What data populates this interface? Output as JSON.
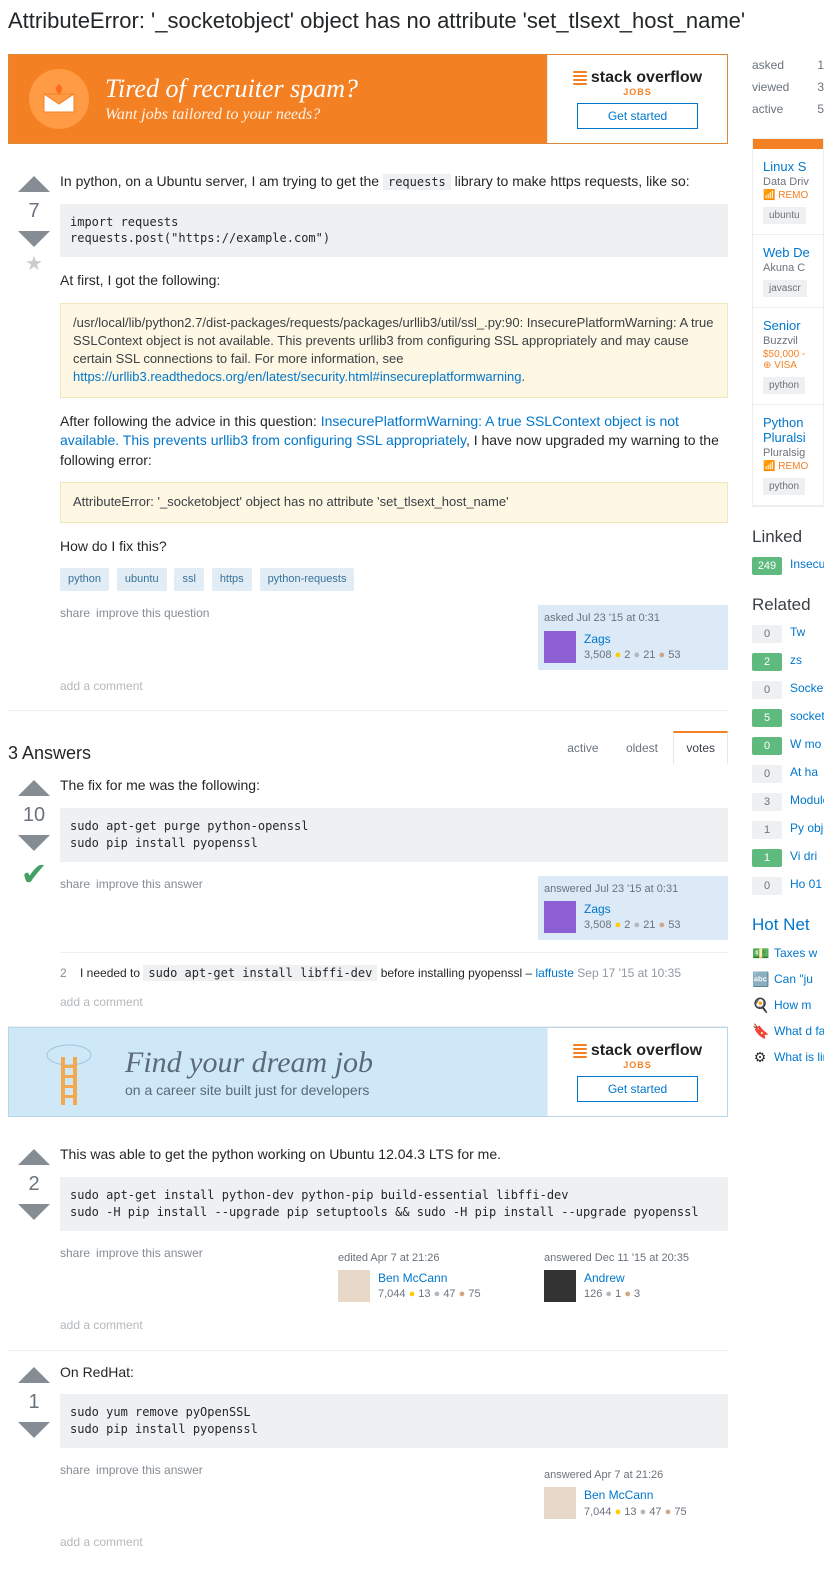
{
  "title": "AttributeError: '_socketobject' object has no attribute 'set_tlsext_host_name'",
  "banner1": {
    "heading": "Tired of recruiter spam?",
    "sub": "Want jobs tailored to your needs?",
    "button": "Get started",
    "logo": "stack overflow",
    "jobs": "JOBS"
  },
  "banner2": {
    "heading": "Find your dream job",
    "sub": "on a career site built just for developers",
    "button": "Get started",
    "logo": "stack overflow",
    "jobs": "JOBS"
  },
  "stats": {
    "asked_label": "asked",
    "asked_val": "1",
    "viewed_label": "viewed",
    "viewed_val": "3",
    "active_label": "active",
    "active_val": "5"
  },
  "question": {
    "score": "7",
    "intro_a": "In python, on a Ubuntu server, I am trying to get the ",
    "intro_code": "requests",
    "intro_b": " library to make https requests, like so:",
    "code1": "import requests\nrequests.post(\"https://example.com\")",
    "at_first": "At first, I got the following:",
    "warn_a": "/usr/local/lib/python2.7/dist-packages/requests/packages/urllib3/util/ssl_.py:90: InsecurePlatformWarning: A true SSLContext object is not available. This prevents urllib3 from configuring SSL appropriately and may cause certain SSL connections to fail. For more information, see ",
    "warn_link": "https://urllib3.readthedocs.org/en/latest/security.html#insecureplatformwarning",
    "warn_b": ".",
    "after_a": "After following the advice in this question: ",
    "after_link": "InsecurePlatformWarning: A true SSLContext object is not available. This prevents urllib3 from configuring SSL appropriately",
    "after_b": ", I have now upgraded my warning to the following error:",
    "err": "AttributeError: '_socketobject' object has no attribute 'set_tlsext_host_name'",
    "howfix": "How do I fix this?",
    "tags": [
      "python",
      "ubuntu",
      "ssl",
      "https",
      "python-requests"
    ],
    "share": "share",
    "improve": "improve this question",
    "card": {
      "time": "asked Jul 23 '15 at 0:31",
      "name": "Zags",
      "rep": "3,508",
      "gold": "2",
      "silver": "21",
      "bronze": "53"
    },
    "addcomment": "add a comment"
  },
  "answers_hdr": {
    "count": "3 Answers",
    "tabs": {
      "active": "active",
      "oldest": "oldest",
      "votes": "votes"
    }
  },
  "answer1": {
    "score": "10",
    "text": "The fix for me was the following:",
    "code": "sudo apt-get purge python-openssl\nsudo pip install pyopenssl",
    "share": "share",
    "improve": "improve this answer",
    "card": {
      "time": "answered Jul 23 '15 at 0:31",
      "name": "Zags",
      "rep": "3,508",
      "gold": "2",
      "silver": "21",
      "bronze": "53"
    },
    "comment": {
      "num": "2",
      "t1": "I needed to ",
      "code": "sudo apt-get install libffi-dev",
      "t2": " before installing pyopenssl – ",
      "author": "laffuste",
      "date": "Sep 17 '15 at 10:35"
    },
    "addcomment": "add a comment"
  },
  "answer2": {
    "score": "2",
    "text": "This was able to get the python working on Ubuntu 12.04.3 LTS for me.",
    "code": "sudo apt-get install python-dev python-pip build-essential libffi-dev\nsudo -H pip install --upgrade pip setuptools && sudo -H pip install --upgrade pyopenssl",
    "share": "share",
    "improve": "improve this answer",
    "editcard": {
      "time": "edited Apr 7 at 21:26",
      "name": "Ben McCann",
      "rep": "7,044",
      "gold": "13",
      "silver": "47",
      "bronze": "75"
    },
    "card": {
      "time": "answered Dec 11 '15 at 20:35",
      "name": "Andrew",
      "rep": "126",
      "gold": "",
      "silver": "1",
      "bronze": "3"
    },
    "addcomment": "add a comment"
  },
  "answer3": {
    "score": "1",
    "text": "On RedHat:",
    "code": "sudo yum remove pyOpenSSL\nsudo pip install pyopenssl",
    "share": "share",
    "improve": "improve this answer",
    "card": {
      "time": "answered Apr 7 at 21:26",
      "name": "Ben McCann",
      "rep": "7,044",
      "gold": "13",
      "silver": "47",
      "bronze": "75"
    },
    "addcomment": "add a comment"
  },
  "jobs": [
    {
      "title": "Linux S",
      "co": "Data Driv",
      "meta": "📶 REMO",
      "tags": [
        "ubuntu"
      ]
    },
    {
      "title": "Web De",
      "co": "Akuna C",
      "meta": "",
      "tags": [
        "javascr"
      ]
    },
    {
      "title": "Senior",
      "co": "Buzzvil",
      "meta": "$50,000 -",
      "meta2": "⊕ VISA",
      "tags": [
        "python"
      ]
    },
    {
      "title": "Python Pluralsi",
      "co": "Pluralsig",
      "meta": "📶 REMO",
      "tags": [
        "python"
      ]
    }
  ],
  "linked_h": "Linked",
  "linked": [
    {
      "score": "249",
      "hi": true,
      "text": "InsecurePlatformWarning: A true SSLContext object is not available. This prevents urllib3 from configuring SSL appropriately"
    }
  ],
  "related_h": "Related",
  "related": [
    {
      "score": "0",
      "hi": false,
      "text": "Tw"
    },
    {
      "score": "2",
      "hi": true,
      "text": "zs"
    },
    {
      "score": "0",
      "hi": false,
      "text": "Socketobject has no attribute '_socketobject' really"
    },
    {
      "score": "5",
      "hi": true,
      "text": "socketobject AttributeError att"
    },
    {
      "score": "0",
      "hi": true,
      "text": "W mo"
    },
    {
      "score": "0",
      "hi": false,
      "text": "At ha"
    },
    {
      "score": "3",
      "hi": false,
      "text": "Module no Py"
    },
    {
      "score": "1",
      "hi": false,
      "text": "Py object 'ge"
    },
    {
      "score": "1",
      "hi": true,
      "text": "Vi dri"
    },
    {
      "score": "0",
      "hi": false,
      "text": "Ho 01"
    }
  ],
  "hot_h": "Hot Net",
  "hot": [
    {
      "icon": "💵",
      "text": "Taxes w"
    },
    {
      "icon": "🔤",
      "text": "Can \"ju"
    },
    {
      "icon": "🍳",
      "text": "How m"
    },
    {
      "icon": "🔖",
      "text": "What d favorab"
    },
    {
      "icon": "⚙",
      "text": "What is line?"
    }
  ]
}
